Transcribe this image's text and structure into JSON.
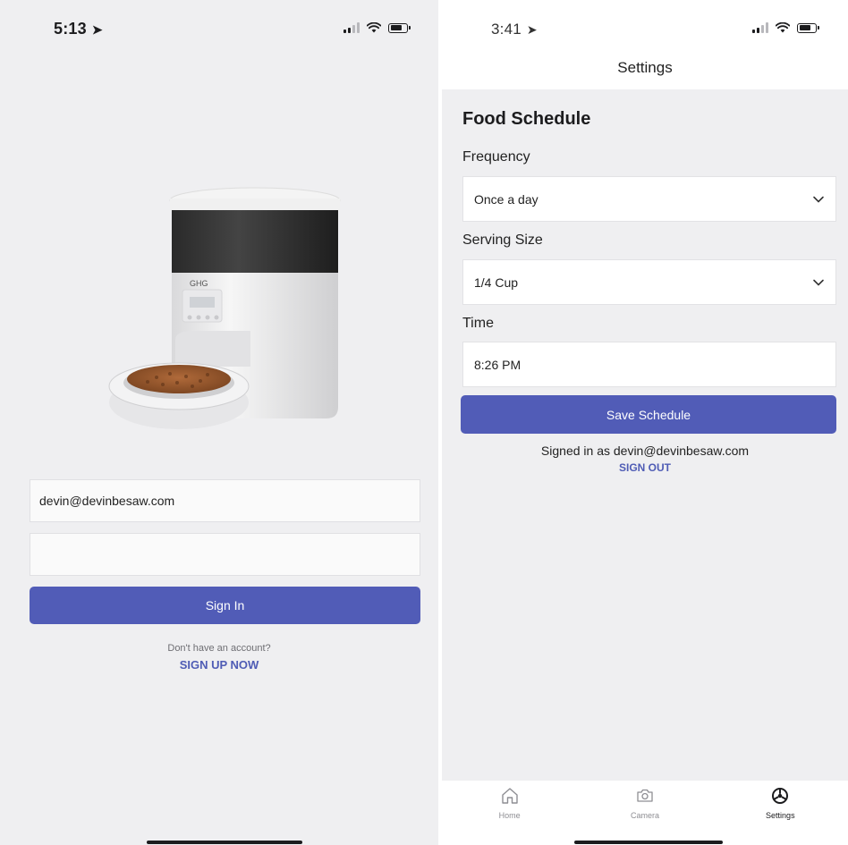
{
  "login": {
    "status_time": "5:13",
    "email_value": "devin@devinbesaw.com",
    "password_value": "",
    "sign_in_label": "Sign In",
    "no_account_text": "Don't have an account?",
    "sign_up_label": "SIGN UP NOW",
    "product_brand": "GHG"
  },
  "settings": {
    "status_time": "3:41",
    "nav_title": "Settings",
    "section_title": "Food Schedule",
    "frequency_label": "Frequency",
    "frequency_value": "Once a day",
    "serving_label": "Serving Size",
    "serving_value": "1/4 Cup",
    "time_label": "Time",
    "time_value": "8:26 PM",
    "save_label": "Save Schedule",
    "signed_in_text": "Signed in as devin@devinbesaw.com",
    "sign_out_label": "SIGN OUT",
    "tabs": [
      {
        "label": "Home",
        "icon": "home-icon"
      },
      {
        "label": "Camera",
        "icon": "camera-icon"
      },
      {
        "label": "Settings",
        "icon": "settings-icon"
      }
    ]
  },
  "colors": {
    "accent": "#515cb7",
    "link": "#4f5cb5",
    "background": "#efeff1"
  }
}
